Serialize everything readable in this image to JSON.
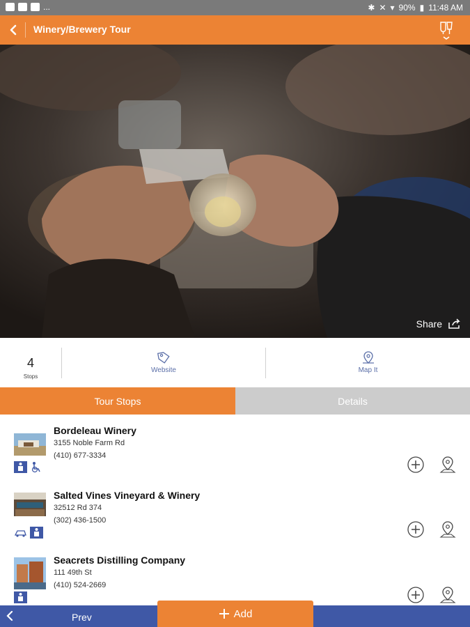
{
  "status_bar": {
    "battery": "90%",
    "time": "11:48 AM",
    "notif_more": "..."
  },
  "app_bar": {
    "title": "Winery/Brewery Tour",
    "back_icon": "chevron-left-icon",
    "menu_icon": "tour-drinks-icon"
  },
  "hero": {
    "share_label": "Share"
  },
  "info": {
    "stops_count": "4",
    "stops_label": "Stops",
    "website_label": "Website",
    "mapit_label": "Map It"
  },
  "tabs": {
    "tour_stops": "Tour Stops",
    "details": "Details"
  },
  "stops": [
    {
      "name": "Bordeleau Winery",
      "address": "3155 Noble Farm Rd",
      "phone": "(410) 677-3334"
    },
    {
      "name": "Salted Vines Vineyard & Winery",
      "address": "32512 Rd 374",
      "phone": "(302) 436-1500"
    },
    {
      "name": "Seacrets Distilling Company",
      "address": "111 49th St",
      "phone": "(410) 524-2669"
    }
  ],
  "bottom_bar": {
    "prev_label": "Prev",
    "add_label": "Add"
  },
  "colors": {
    "orange": "#ec8334",
    "blue": "#3f58a6",
    "link": "#5b6fa8",
    "gray_tab": "#cccccc"
  }
}
